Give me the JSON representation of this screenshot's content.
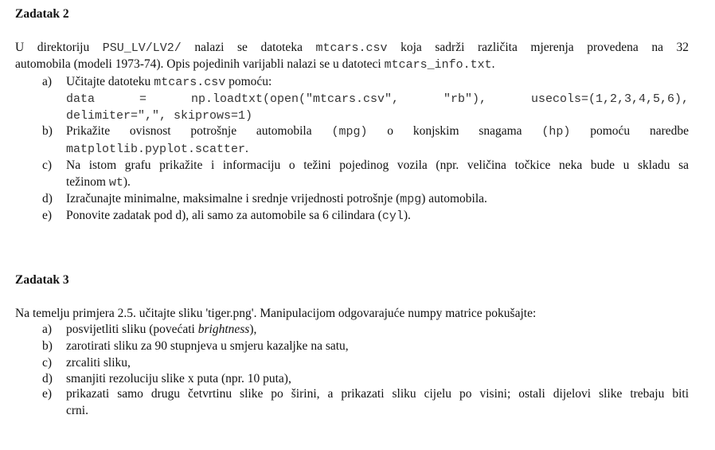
{
  "task2": {
    "heading": "Zadatak 2",
    "intro_line1_a": "U direktoriju",
    "intro_line1_code": "PSU_LV/LV2/",
    "intro_line1_b": "nalazi se datoteka",
    "intro_line1_code2": "mtcars.csv",
    "intro_line1_c": "koja sadrži različita mjerenja provedena na 32",
    "intro_line2_a": "automobila (modeli 1973-74). Opis pojedinih varijabli nalazi se u datoteci",
    "intro_line2_code": "mtcars_info.txt",
    "intro_line2_b": ".",
    "items": [
      {
        "label": "a)",
        "text_a": "Učitajte datoteku",
        "code": "mtcars.csv",
        "text_b": "pomoću:",
        "code_line1": "data   =   np.loadtxt(open(\"mtcars.csv\",   \"rb\"),   usecols=(1,2,3,4,5,6),",
        "code_line2": "delimiter=\",\", skiprows=1)"
      },
      {
        "label": "b)",
        "text_a": "Prikažite ovisnost potrošnje automobila",
        "code_a": "(mpg)",
        "text_b": "o konjskim snagama",
        "code_b": "(hp)",
        "text_c": "pomoću naredbe",
        "code_line2": "matplotlib.pyplot.scatter",
        "text_d": "."
      },
      {
        "label": "c)",
        "line1": "Na istom grafu prikažite i informaciju o težini pojedinog vozila (npr. veličina točkice neka bude u skladu sa",
        "line2_a": "težinom",
        "code": "wt",
        "line2_b": ")."
      },
      {
        "label": "d)",
        "text_a": "Izračunajte minimalne, maksimalne i srednje vrijednosti potrošnje (",
        "code": "mpg",
        "text_b": ") automobila."
      },
      {
        "label": "e)",
        "text_a": "Ponovite zadatak pod d), ali samo za automobile sa 6 cilindara (",
        "code": "cyl",
        "text_b": ")."
      }
    ]
  },
  "task3": {
    "heading": "Zadatak 3",
    "intro": "Na temelju primjera 2.5. učitajte sliku 'tiger.png'. Manipulacijom odgovarajuće numpy matrice pokušajte:",
    "items": [
      {
        "label": "a)",
        "text_a": "posvijetliti sliku (povećati ",
        "italic": "brightness",
        "text_b": "),"
      },
      {
        "label": "b)",
        "text": "zarotirati sliku za 90 stupnjeva u smjeru kazaljke na satu,"
      },
      {
        "label": "c)",
        "text": "zrcaliti sliku,"
      },
      {
        "label": "d)",
        "text": "smanjiti rezoluciju slike x puta (npr. 10 puta),"
      },
      {
        "label": "e)",
        "line1": "prikazati samo drugu četvrtinu slike po širini, a prikazati sliku cijelu po visini; ostali dijelovi slike trebaju biti",
        "line2": "crni."
      }
    ]
  }
}
